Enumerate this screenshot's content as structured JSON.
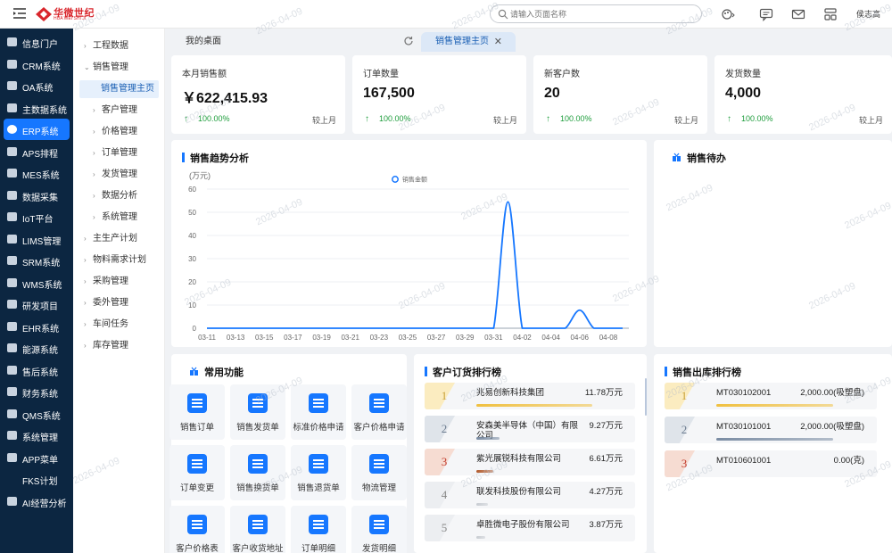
{
  "topbar": {
    "logo_cn": "华微世纪",
    "logo_en": "HUA WEI SHI JI",
    "search_placeholder": "请输入页面名称",
    "user": "侯志高"
  },
  "sidebar": {
    "items": [
      {
        "label": "信息门户",
        "icon": "portal-icon"
      },
      {
        "label": "CRM系统",
        "icon": "crm-icon"
      },
      {
        "label": "OA系统",
        "icon": "oa-icon"
      },
      {
        "label": "主数据系统",
        "icon": "master-data-icon"
      },
      {
        "label": "ERP系统",
        "icon": "erp-icon",
        "active": true
      },
      {
        "label": "APS排程",
        "icon": "aps-icon"
      },
      {
        "label": "MES系统",
        "icon": "mes-icon"
      },
      {
        "label": "数据采集",
        "icon": "data-collect-icon"
      },
      {
        "label": "IoT平台",
        "icon": "iot-icon"
      },
      {
        "label": "LIMS管理",
        "icon": "lims-icon"
      },
      {
        "label": "SRM系统",
        "icon": "srm-icon"
      },
      {
        "label": "WMS系统",
        "icon": "wms-icon"
      },
      {
        "label": "研发项目",
        "icon": "rd-icon"
      },
      {
        "label": "EHR系统",
        "icon": "ehr-icon"
      },
      {
        "label": "能源系统",
        "icon": "energy-icon"
      },
      {
        "label": "售后系统",
        "icon": "after-sales-icon"
      },
      {
        "label": "财务系统",
        "icon": "finance-icon"
      },
      {
        "label": "QMS系统",
        "icon": "qms-icon"
      },
      {
        "label": "系统管理",
        "icon": "system-icon"
      },
      {
        "label": "APP菜单",
        "icon": "app-icon"
      },
      {
        "label": "FKS计划",
        "icon": ""
      },
      {
        "label": "AI经营分析",
        "icon": "ai-icon"
      }
    ]
  },
  "subnav": {
    "items": [
      {
        "label": "工程数据",
        "arrow": "›",
        "level": 0
      },
      {
        "label": "销售管理",
        "arrow": "⌄",
        "level": 0
      },
      {
        "label": "销售管理主页",
        "arrow": "",
        "level": 1,
        "active": true
      },
      {
        "label": "客户管理",
        "arrow": "›",
        "level": 1
      },
      {
        "label": "价格管理",
        "arrow": "›",
        "level": 1
      },
      {
        "label": "订单管理",
        "arrow": "›",
        "level": 1
      },
      {
        "label": "发货管理",
        "arrow": "›",
        "level": 1
      },
      {
        "label": "数据分析",
        "arrow": "›",
        "level": 1
      },
      {
        "label": "系统管理",
        "arrow": "›",
        "level": 1
      },
      {
        "label": "主生产计划",
        "arrow": "›",
        "level": 0
      },
      {
        "label": "物料需求计划",
        "arrow": "›",
        "level": 0
      },
      {
        "label": "采购管理",
        "arrow": "›",
        "level": 0
      },
      {
        "label": "委外管理",
        "arrow": "›",
        "level": 0
      },
      {
        "label": "车间任务",
        "arrow": "›",
        "level": 0
      },
      {
        "label": "库存管理",
        "arrow": "›",
        "level": 0
      }
    ]
  },
  "tabs": {
    "home": "我的桌面",
    "active": "销售管理主页",
    "close": "✕"
  },
  "kpis": [
    {
      "title": "本月销售额",
      "value": "￥622,415.93",
      "trend": "↑",
      "pct": "100.00%",
      "compare": "较上月"
    },
    {
      "title": "订单数量",
      "value": "167,500",
      "trend": "↑",
      "pct": "100.00%",
      "compare": "较上月"
    },
    {
      "title": "新客户数",
      "value": "20",
      "trend": "↑",
      "pct": "100.00%",
      "compare": "较上月"
    },
    {
      "title": "发货数量",
      "value": "4,000",
      "trend": "↑",
      "pct": "100.00%",
      "compare": "较上月"
    }
  ],
  "trend": {
    "title": "销售趋势分析"
  },
  "todo": {
    "title": "销售待办"
  },
  "chart_data": {
    "type": "line",
    "title": "",
    "ylabel": "(万元)",
    "xlabel": "",
    "legend": "top-center",
    "ylim": [
      0,
      60
    ],
    "yticks": [
      "0",
      "10",
      "20",
      "30",
      "40",
      "50",
      "60"
    ],
    "xticks": [
      "03-11",
      "03-13",
      "03-15",
      "03-17",
      "03-19",
      "03-21",
      "03-23",
      "03-25",
      "03-27",
      "03-29",
      "03-31",
      "04-02",
      "04-04",
      "04-06",
      "04-08"
    ],
    "series": [
      {
        "name": "销售金额",
        "color": "#1677ff",
        "x": [
          "03-11",
          "03-12",
          "03-13",
          "03-14",
          "03-15",
          "03-16",
          "03-17",
          "03-18",
          "03-19",
          "03-20",
          "03-21",
          "03-22",
          "03-23",
          "03-24",
          "03-25",
          "03-26",
          "03-27",
          "03-28",
          "03-29",
          "03-30",
          "03-31",
          "04-01",
          "04-02",
          "04-03",
          "04-04",
          "04-05",
          "04-06",
          "04-07",
          "04-08",
          "04-09"
        ],
        "values": [
          0,
          0,
          0,
          0,
          0,
          0,
          0,
          0,
          0,
          0,
          0,
          0,
          0,
          0,
          0,
          0,
          0,
          0,
          0,
          0,
          0,
          54.5,
          0,
          0,
          0,
          0,
          7.8,
          0,
          0,
          0
        ]
      }
    ]
  },
  "functions": {
    "title": "常用功能",
    "items": [
      {
        "label": "销售订单",
        "icon": "sales-order-icon"
      },
      {
        "label": "销售发货单",
        "icon": "delivery-icon"
      },
      {
        "label": "标准价格申请",
        "icon": "price-apply-icon"
      },
      {
        "label": "客户价格申请",
        "icon": "customer-price-icon"
      },
      {
        "label": "订单变更",
        "icon": "order-change-icon"
      },
      {
        "label": "销售换货单",
        "icon": "exchange-icon"
      },
      {
        "label": "销售退货单",
        "icon": "return-icon"
      },
      {
        "label": "物流管理",
        "icon": "logistics-icon"
      },
      {
        "label": "客户价格表",
        "icon": "price-table-icon"
      },
      {
        "label": "客户收货地址",
        "icon": "address-icon"
      },
      {
        "label": "订单明细",
        "icon": "order-detail-icon"
      },
      {
        "label": "发货明细",
        "icon": "delivery-detail-icon"
      }
    ]
  },
  "customer_rank": {
    "title": "客户订货排行榜",
    "rows": [
      {
        "rank": "1",
        "name": "兆易创新科技集团",
        "value": "11.78万元",
        "ratio": 1.0,
        "color": "#f0c040"
      },
      {
        "rank": "2",
        "name": "安森美半导体（中国）有限公司",
        "value": "9.27万元",
        "ratio": 0.2,
        "color": "#7a8ca3"
      },
      {
        "rank": "3",
        "name": "紫光展锐科技有限公司",
        "value": "6.61万元",
        "ratio": 0.15,
        "color": "#b25a2c"
      },
      {
        "rank": "4",
        "name": "联发科技股份有限公司",
        "value": "4.27万元",
        "ratio": 0.1,
        "color": "#c8ccd2"
      },
      {
        "rank": "5",
        "name": "卓胜微电子股份有限公司",
        "value": "3.87万元",
        "ratio": 0.08,
        "color": "#c8ccd2"
      }
    ]
  },
  "outbound_rank": {
    "title": "销售出库排行榜",
    "rows": [
      {
        "rank": "1",
        "name": "MT030102001",
        "value": "2,000.00(吸塑盘)",
        "ratio": 1.0,
        "color": "#f0c040"
      },
      {
        "rank": "2",
        "name": "MT030101001",
        "value": "2,000.00(吸塑盘)",
        "ratio": 1.0,
        "color": "#7a8ca3"
      },
      {
        "rank": "3",
        "name": "MT010601001",
        "value": "0.00(克)",
        "ratio": 0,
        "color": "#b25a2c"
      }
    ]
  },
  "watermark": "2026-04-09"
}
